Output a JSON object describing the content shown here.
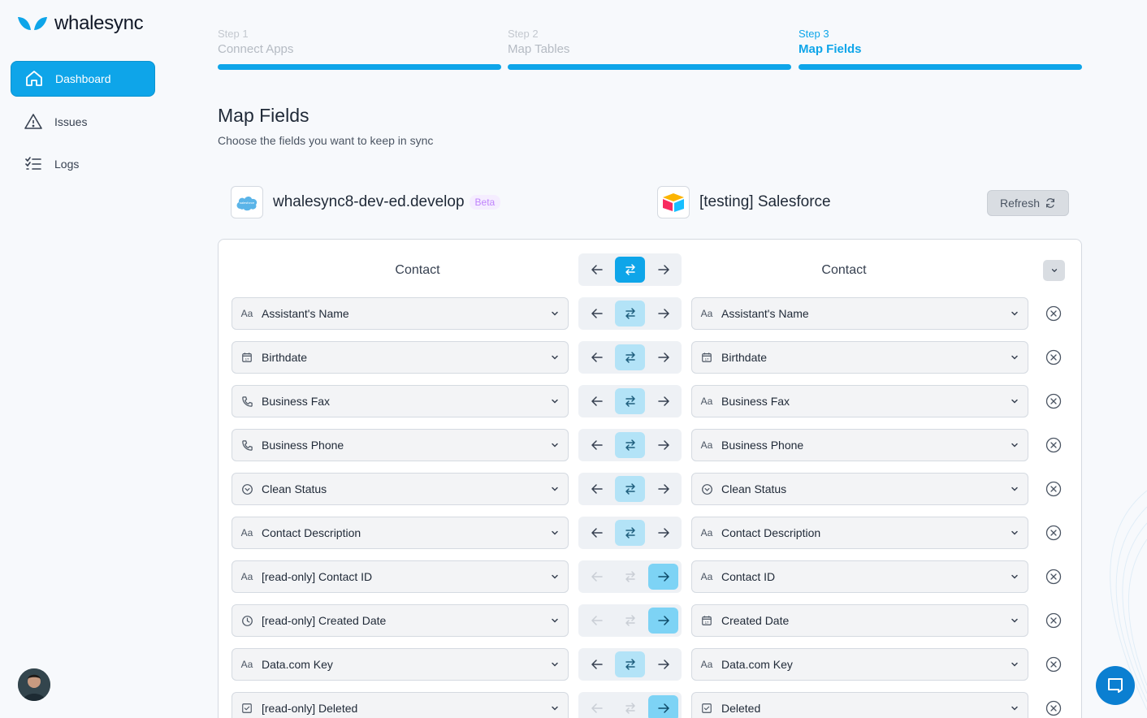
{
  "brand": {
    "name": "whalesync",
    "accent": "#0ea5e9"
  },
  "nav": [
    {
      "label": "Dashboard",
      "icon": "home-icon",
      "active": true
    },
    {
      "label": "Issues",
      "icon": "warning-icon",
      "active": false
    },
    {
      "label": "Logs",
      "icon": "list-check-icon",
      "active": false
    }
  ],
  "steps": [
    {
      "num": "Step 1",
      "name": "Connect Apps",
      "state": "done"
    },
    {
      "num": "Step 2",
      "name": "Map Tables",
      "state": "done"
    },
    {
      "num": "Step 3",
      "name": "Map Fields",
      "state": "current"
    }
  ],
  "page": {
    "title": "Map Fields",
    "subtitle": "Choose the fields you want to keep in sync"
  },
  "left_app": {
    "name": "whalesync8-dev-ed.develop",
    "badge": "Beta",
    "icon": "salesforce-icon"
  },
  "right_app": {
    "name": "[testing] Salesforce",
    "icon": "airtable-icon"
  },
  "refresh_label": "Refresh",
  "table": {
    "left_header": "Contact",
    "right_header": "Contact"
  },
  "rows": [
    {
      "left": "Assistant's Name",
      "left_icon": "text-icon",
      "right": "Assistant's Name",
      "right_icon": "text-icon",
      "direction": "both"
    },
    {
      "left": "Birthdate",
      "left_icon": "calendar-icon",
      "right": "Birthdate",
      "right_icon": "calendar-icon",
      "direction": "both"
    },
    {
      "left": "Business Fax",
      "left_icon": "phone-icon",
      "right": "Business Fax",
      "right_icon": "text-icon",
      "direction": "both"
    },
    {
      "left": "Business Phone",
      "left_icon": "phone-icon",
      "right": "Business Phone",
      "right_icon": "text-icon",
      "direction": "both"
    },
    {
      "left": "Clean Status",
      "left_icon": "select-icon",
      "right": "Clean Status",
      "right_icon": "select-icon",
      "direction": "both"
    },
    {
      "left": "Contact Description",
      "left_icon": "text-icon",
      "right": "Contact Description",
      "right_icon": "text-icon",
      "direction": "both"
    },
    {
      "left": "[read-only] Contact ID",
      "left_icon": "text-icon",
      "right": "Contact ID",
      "right_icon": "text-icon",
      "direction": "right"
    },
    {
      "left": "[read-only] Created Date",
      "left_icon": "clock-icon",
      "right": "Created Date",
      "right_icon": "calendar-icon",
      "direction": "right"
    },
    {
      "left": "Data.com Key",
      "left_icon": "text-icon",
      "right": "Data.com Key",
      "right_icon": "text-icon",
      "direction": "both"
    },
    {
      "left": "[read-only] Deleted",
      "left_icon": "checkbox-icon",
      "right": "Deleted",
      "right_icon": "checkbox-icon",
      "direction": "right"
    }
  ]
}
